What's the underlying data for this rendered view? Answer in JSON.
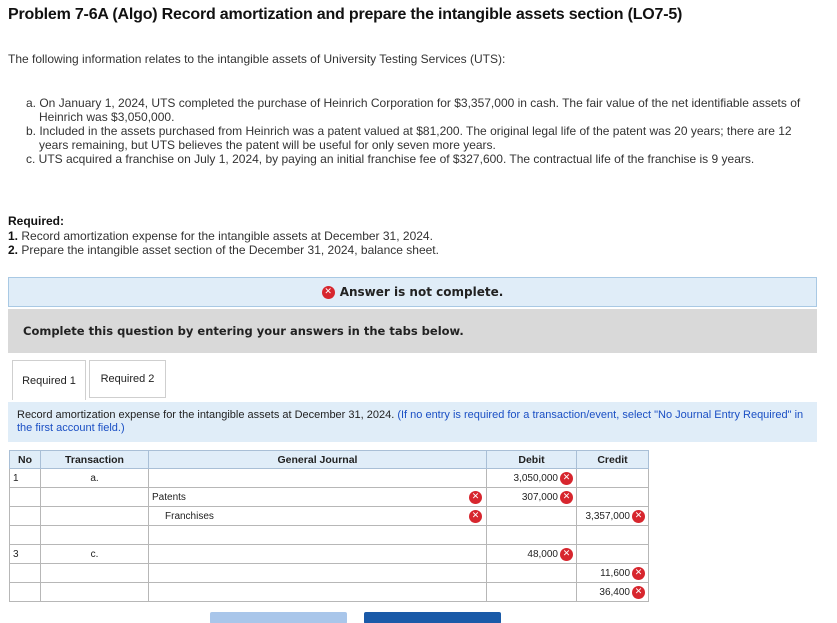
{
  "title": "Problem 7-6A (Algo) Record amortization and prepare the intangible assets section (LO7-5)",
  "intro": "The following information relates to the intangible assets of University Testing Services (UTS):",
  "items": [
    "a. On January 1, 2024, UTS completed the purchase of Heinrich Corporation for $3,357,000 in cash. The fair value of the net identifiable assets of Heinrich was $3,050,000.",
    "b. Included in the assets purchased from Heinrich was a patent valued at $81,200. The original legal life of the patent was 20 years; there are 12 years remaining, but UTS believes the patent will be useful for only seven more years.",
    "c. UTS acquired a franchise on July 1, 2024, by paying an initial franchise fee of $327,600. The contractual life of the franchise is 9 years."
  ],
  "required": {
    "heading": "Required:",
    "r1_num": "1.",
    "r1_text": " Record amortization expense for the intangible assets at December 31, 2024.",
    "r2_num": "2.",
    "r2_text": " Prepare the intangible asset section of the December 31, 2024, balance sheet."
  },
  "banner": {
    "text": "Answer is not complete.",
    "icon": "x-circle-icon",
    "color": "#d7262e"
  },
  "complete_prompt": "Complete this question by entering your answers in the tabs below.",
  "tabs": [
    {
      "label": "Required 1",
      "active": true
    },
    {
      "label": "Required 2",
      "active": false
    }
  ],
  "instruction": {
    "main": "Record amortization expense for the intangible assets at December 31, 2024. ",
    "note": "(If no entry is required for a transaction/event, select \"No Journal Entry Required\" in the first account field.)"
  },
  "journal": {
    "headers": {
      "no": "No",
      "transaction": "Transaction",
      "general_journal": "General Journal",
      "debit": "Debit",
      "credit": "Credit"
    },
    "rows": [
      {
        "no": "1",
        "transaction": "a.",
        "account": "",
        "indent": false,
        "account_x": false,
        "debit": "3,050,000",
        "debit_x": true,
        "credit": "",
        "credit_x": false
      },
      {
        "no": "",
        "transaction": "",
        "account": "Patents",
        "indent": false,
        "account_x": true,
        "debit": "307,000",
        "debit_x": true,
        "credit": "",
        "credit_x": false
      },
      {
        "no": "",
        "transaction": "",
        "account": "Franchises",
        "indent": true,
        "account_x": true,
        "debit": "",
        "debit_x": false,
        "credit": "3,357,000",
        "credit_x": true
      },
      {
        "no": "",
        "transaction": "",
        "account": "",
        "indent": false,
        "account_x": false,
        "debit": "",
        "debit_x": false,
        "credit": "",
        "credit_x": false
      },
      {
        "no": "3",
        "transaction": "c.",
        "account": "",
        "indent": false,
        "account_x": false,
        "debit": "48,000",
        "debit_x": true,
        "credit": "",
        "credit_x": false
      },
      {
        "no": "",
        "transaction": "",
        "account": "",
        "indent": false,
        "account_x": false,
        "debit": "",
        "debit_x": false,
        "credit": "11,600",
        "credit_x": true
      },
      {
        "no": "",
        "transaction": "",
        "account": "",
        "indent": false,
        "account_x": false,
        "debit": "",
        "debit_x": false,
        "credit": "36,400",
        "credit_x": true
      }
    ]
  },
  "colors": {
    "accent_light": "#e0edf8",
    "error": "#d7262e",
    "note_blue": "#1a4fc4"
  }
}
